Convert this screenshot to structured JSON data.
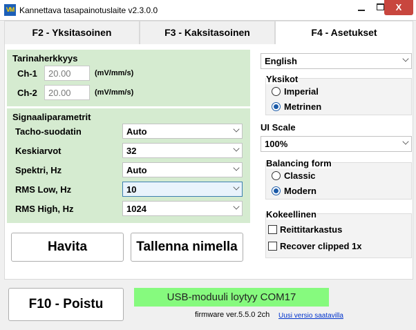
{
  "window": {
    "title": "Kannettava tasapainotuslaite v2.3.0.0",
    "icon_text": "VM",
    "minimize": "",
    "maximize": "",
    "close": "X"
  },
  "tabs": [
    {
      "label": "F2 - Yksitasoinen",
      "active": false
    },
    {
      "label": "F3 - Kaksitasoinen",
      "active": false
    },
    {
      "label": "F4 - Asetukset",
      "active": true
    }
  ],
  "sensitivity": {
    "title": "Tarinaherkkyys",
    "rows": [
      {
        "label": "Ch-1",
        "value": "20.00",
        "unit": "(mV/mm/s)"
      },
      {
        "label": "Ch-2",
        "value": "20.00",
        "unit": "(mV/mm/s)"
      }
    ]
  },
  "signal": {
    "title": "Signaaliparametrit",
    "rows": [
      {
        "label": "Tacho-suodatin",
        "value": "Auto"
      },
      {
        "label": "Keskiarvot",
        "value": "32"
      },
      {
        "label": "Spektri, Hz",
        "value": "Auto"
      },
      {
        "label": "RMS Low, Hz",
        "value": "10"
      },
      {
        "label": "RMS High, Hz",
        "value": "1024"
      }
    ]
  },
  "buttons": {
    "cancel": "Havita",
    "save_as": "Tallenna nimella",
    "exit": "F10 - Poistu"
  },
  "language": {
    "value": "English"
  },
  "units": {
    "title": "Yksikot",
    "options": [
      "Imperial",
      "Metrinen"
    ],
    "selected": "Metrinen"
  },
  "ui_scale": {
    "title": "UI Scale",
    "value": "100%"
  },
  "balancing_form": {
    "title": "Balancing form",
    "options": [
      "Classic",
      "Modern"
    ],
    "selected": "Modern"
  },
  "experimental": {
    "title": "Kokeellinen",
    "items": [
      {
        "label": "Reittitarkastus",
        "checked": false
      },
      {
        "label": "Recover clipped 1x",
        "checked": false
      }
    ]
  },
  "status": {
    "text": "USB-moduuli loytyy COM17",
    "color": "#86fa7e"
  },
  "firmware": {
    "text": "firmware ver.5.5.0 2ch"
  },
  "update_link": {
    "text": "Uusi versio saatavilla"
  }
}
